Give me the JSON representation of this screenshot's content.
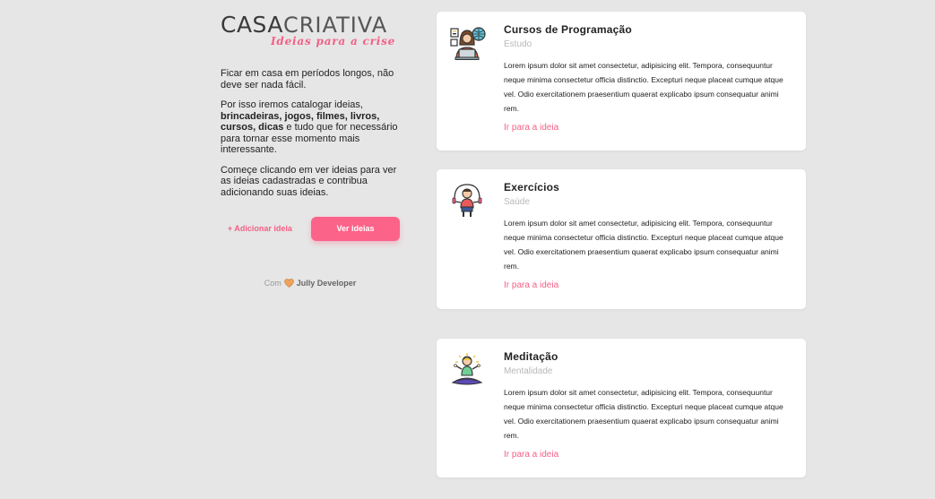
{
  "brand": {
    "name_part1": "CASA",
    "name_part2": "CRIATIVA",
    "tagline": "Ideias para a crise"
  },
  "intro": {
    "p1": "Ficar em casa em períodos longos, não deve ser nada fácil.",
    "p2_start": "Por isso iremos catalogar ideias,",
    "p2_bold": "brincadeiras, jogos, filmes, livros, cursos, dicas",
    "p2_mid": "e tudo que for necessário para tornar esse momento mais",
    "p2_end": "interessante.",
    "p3": "Começe clicando em ver ideias para ver as ideias cadastradas e contribua adicionando suas ideias."
  },
  "actions": {
    "add_label": "+ Adicionar ideia",
    "view_label": "Ver ideias"
  },
  "credit": {
    "prefix": "Com",
    "author": "Jully Developer"
  },
  "colors": {
    "accent": "#fc6389",
    "link": "#f45f86",
    "background": "#e6e6e6"
  },
  "cards": [
    {
      "title": "Cursos de Programação",
      "category": "Estudo",
      "icon": "programmer-icon",
      "description": "Lorem ipsum dolor sit amet consectetur, adipisicing elit. Tempora, consequuntur neque minima consectetur officia distinctio. Excepturi neque placeat cumque atque vel. Odio exercitationem praesentium quaerat explicabo ipsum consequatur animi rem.",
      "link": "Ir para a ideia"
    },
    {
      "title": "Exercícios",
      "category": "Saúde",
      "icon": "jump-rope-icon",
      "description": "Lorem ipsum dolor sit amet consectetur, adipisicing elit. Tempora, consequuntur neque minima consectetur officia distinctio. Excepturi neque placeat cumque atque vel. Odio exercitationem praesentium quaerat explicabo ipsum consequatur animi rem.",
      "link": "Ir para a ideia"
    },
    {
      "title": "Meditação",
      "category": "Mentalidade",
      "icon": "meditation-icon",
      "description": "Lorem ipsum dolor sit amet consectetur, adipisicing elit. Tempora, consequuntur neque minima consectetur officia distinctio. Excepturi neque placeat cumque atque vel. Odio exercitationem praesentium quaerat explicabo ipsum consequatur animi rem.",
      "link": "Ir para a ideia"
    }
  ]
}
